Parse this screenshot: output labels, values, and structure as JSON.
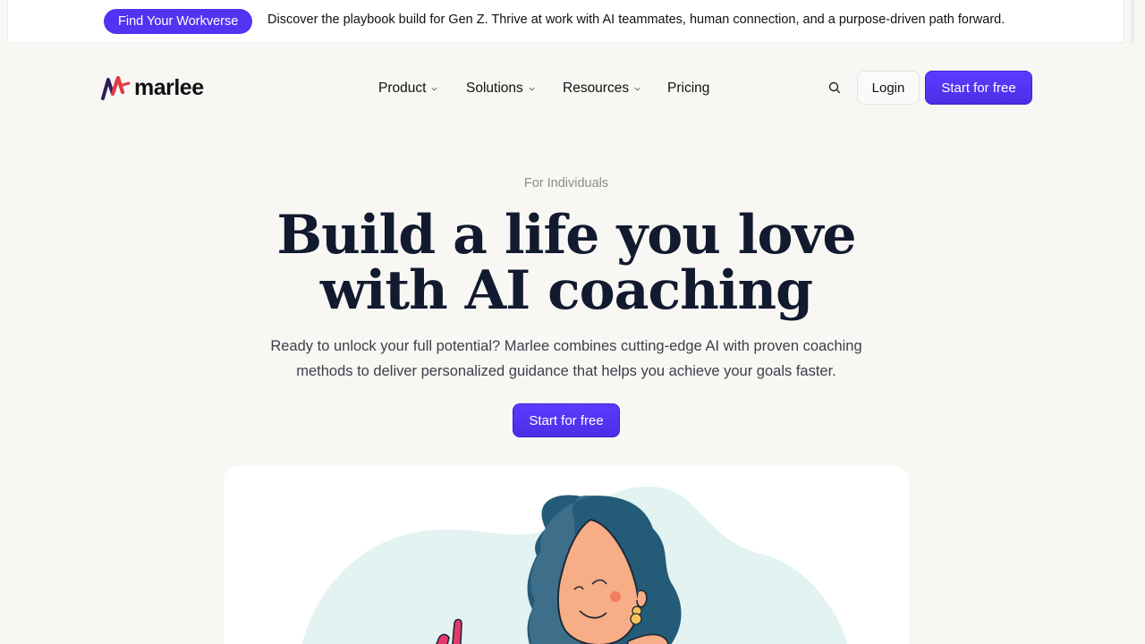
{
  "announcement": {
    "pill_label": "Find Your Workverse",
    "text": "Discover the playbook build for Gen Z. Thrive at work with AI teammates, human connection, and a purpose-driven path forward."
  },
  "header": {
    "logo_text": "marlee",
    "nav": {
      "product": "Product",
      "solutions": "Solutions",
      "resources": "Resources",
      "pricing": "Pricing"
    },
    "login_label": "Login",
    "start_label": "Start for free"
  },
  "hero": {
    "eyebrow": "For Individuals",
    "headline_line1": "Build a life you love",
    "headline_line2": "with AI coaching",
    "subtitle": "Ready to unlock your full potential? Marlee combines cutting-edge AI with proven coaching methods to deliver personalized guidance that helps you achieve your goals faster.",
    "cta_label": "Start for free"
  },
  "colors": {
    "accent": "#5034f2",
    "background": "#f8f7f4",
    "illustration_bg": "#e2f3f1",
    "hair": "#245b78",
    "skin": "#f7ae86"
  },
  "icons": {
    "search": "search-icon",
    "chevron": "chevron-down-icon",
    "logo_mark": "marlee-logo-icon"
  }
}
